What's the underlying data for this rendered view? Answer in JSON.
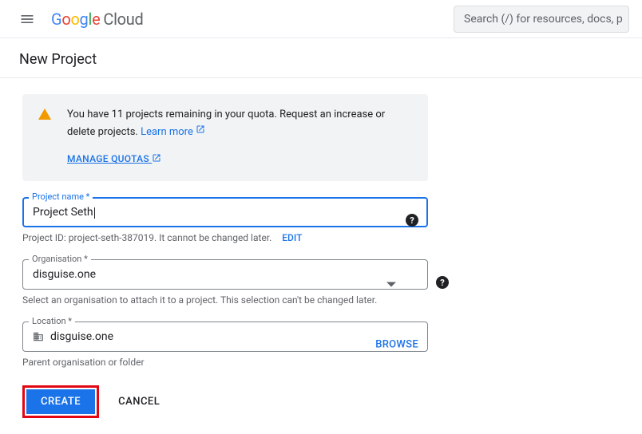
{
  "header": {
    "logo_text": "Google",
    "logo_suffix": "Cloud",
    "search_placeholder": "Search (/) for resources, docs, p"
  },
  "page": {
    "title": "New Project"
  },
  "notice": {
    "text_before": "You have 11 projects remaining in your quota. Request an increase or delete projects. ",
    "learn_more": "Learn more",
    "manage_quotas": "MANAGE QUOTAS"
  },
  "project_name": {
    "label": "Project name *",
    "value": "Project Seth",
    "hint_prefix": "Project ID: project-seth-387019. It cannot be changed later.",
    "edit": "EDIT"
  },
  "organisation": {
    "label": "Organisation *",
    "value": "disguise.one",
    "hint": "Select an organisation to attach it to a project. This selection can't be changed later."
  },
  "location": {
    "label": "Location *",
    "value": "disguise.one",
    "browse": "BROWSE",
    "hint": "Parent organisation or folder"
  },
  "actions": {
    "create": "CREATE",
    "cancel": "CANCEL"
  }
}
